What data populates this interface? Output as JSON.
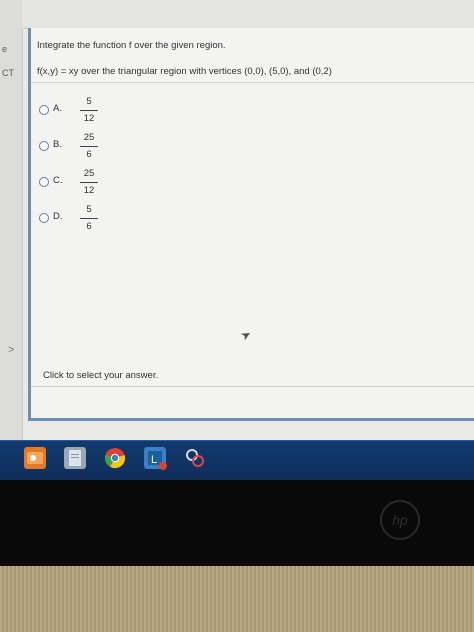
{
  "question": {
    "title": "Integrate the function f over the given region.",
    "body": "f(x,y) = xy over the triangular region with vertices (0,0), (5,0), and (0,2)"
  },
  "options": [
    {
      "letter": "A.",
      "numerator": "5",
      "denominator": "12"
    },
    {
      "letter": "B.",
      "numerator": "25",
      "denominator": "6"
    },
    {
      "letter": "C.",
      "numerator": "25",
      "denominator": "12"
    },
    {
      "letter": "D.",
      "numerator": "5",
      "denominator": "6"
    }
  ],
  "answer_hint": "Click to select your answer.",
  "left_strip": {
    "frag_top": "e",
    "frag_mid": "CT",
    "chevron": ">"
  },
  "taskbar": {
    "icons": [
      {
        "name": "outlook-icon",
        "color": "#e07b2a"
      },
      {
        "name": "file-icon",
        "color": "#9aa7b5"
      },
      {
        "name": "chrome-icon",
        "color": "#d9432f"
      },
      {
        "name": "lockdown-browser-icon",
        "color": "#3b7fc4"
      },
      {
        "name": "snipping-tool-icon",
        "color": "#c7c7c7"
      }
    ]
  },
  "brand": {
    "logo": "hp"
  }
}
